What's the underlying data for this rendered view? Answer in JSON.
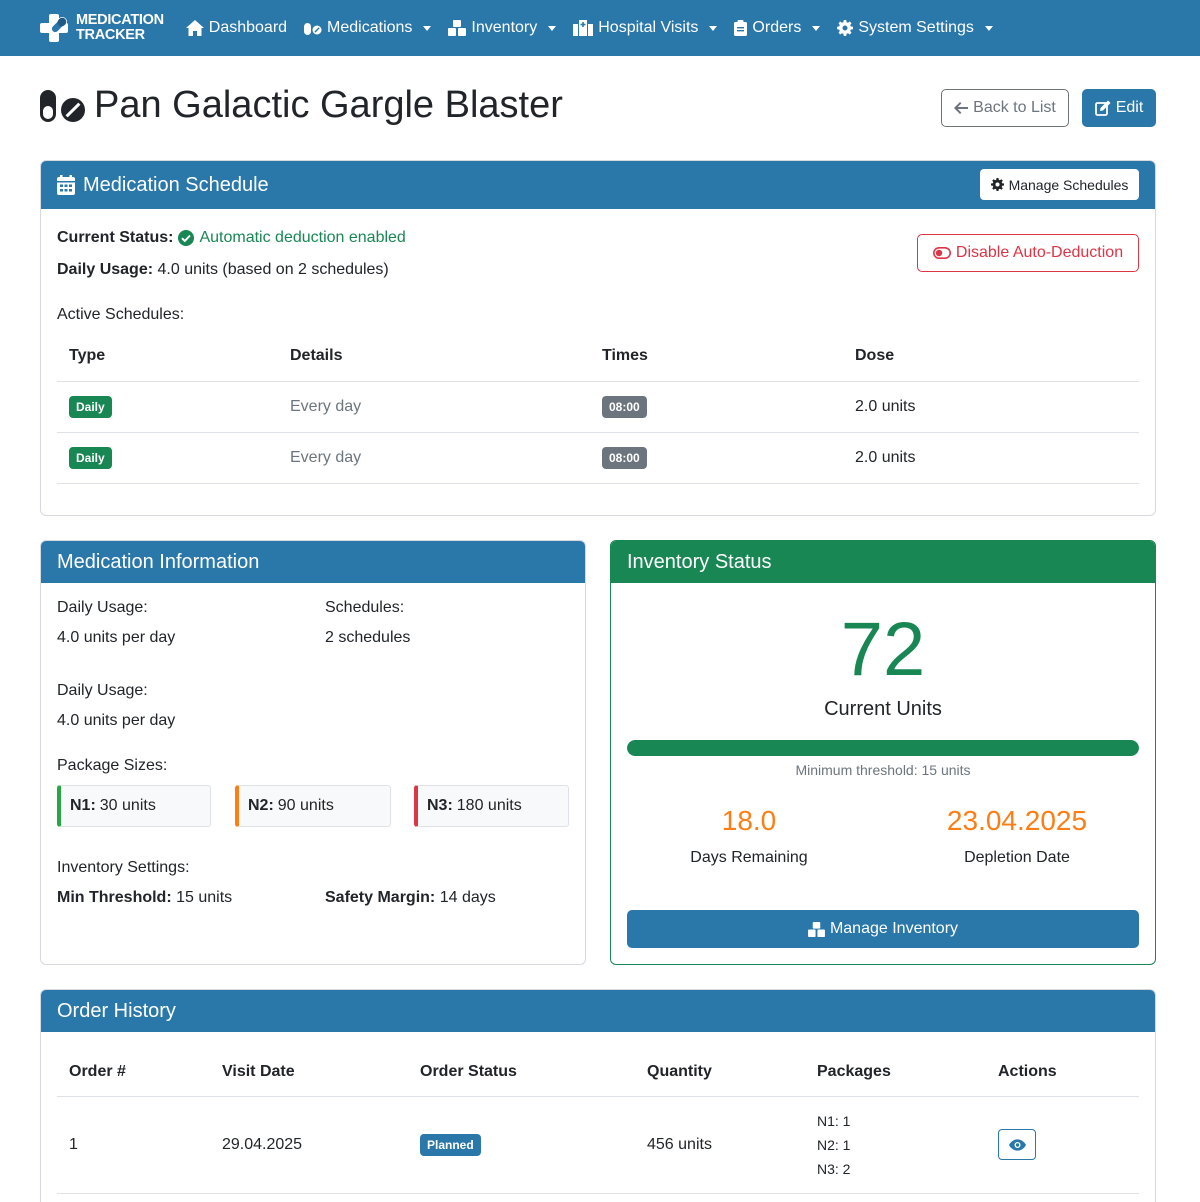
{
  "nav": {
    "brand_line1": "MEDICATION",
    "brand_line2": "TRACKER",
    "items": [
      {
        "label": "Dashboard",
        "icon": "home-icon",
        "dropdown": false
      },
      {
        "label": "Medications",
        "icon": "pills-icon",
        "dropdown": true
      },
      {
        "label": "Inventory",
        "icon": "boxes-icon",
        "dropdown": true
      },
      {
        "label": "Hospital Visits",
        "icon": "hospital-icon",
        "dropdown": true
      },
      {
        "label": "Orders",
        "icon": "clipboard-icon",
        "dropdown": true
      },
      {
        "label": "System Settings",
        "icon": "gear-icon",
        "dropdown": true
      }
    ]
  },
  "header": {
    "title": "Pan Galactic Gargle Blaster",
    "back_label": "Back to List",
    "edit_label": "Edit"
  },
  "schedule": {
    "title": "Medication Schedule",
    "manage_label": "Manage Schedules",
    "status_label": "Current Status:",
    "status_value": "Automatic deduction enabled",
    "usage_label": "Daily Usage:",
    "usage_value": "4.0 units (based on 2 schedules)",
    "disable_label": "Disable Auto-Deduction",
    "active_label": "Active Schedules:",
    "columns": [
      "Type",
      "Details",
      "Times",
      "Dose"
    ],
    "rows": [
      {
        "type": "Daily",
        "details": "Every day",
        "time": "08:00",
        "dose": "2.0 units"
      },
      {
        "type": "Daily",
        "details": "Every day",
        "time": "08:00",
        "dose": "2.0 units"
      }
    ]
  },
  "info": {
    "title": "Medication Information",
    "daily_usage_label": "Daily Usage:",
    "daily_usage_value": "4.0 units per day",
    "schedules_label": "Schedules:",
    "schedules_value": "2 schedules",
    "daily_usage_label2": "Daily Usage:",
    "daily_usage_value2": "4.0 units per day",
    "package_label": "Package Sizes:",
    "packages": [
      {
        "name": "N1:",
        "value": "30 units",
        "color": "#28a745"
      },
      {
        "name": "N2:",
        "value": "90 units",
        "color": "#fd7e14"
      },
      {
        "name": "N3:",
        "value": "180 units",
        "color": "#dc3545"
      }
    ],
    "settings_label": "Inventory Settings:",
    "min_threshold_label": "Min Threshold:",
    "min_threshold_value": "15 units",
    "safety_margin_label": "Safety Margin:",
    "safety_margin_value": "14 days"
  },
  "inventory": {
    "title": "Inventory Status",
    "current_units": "72",
    "current_units_label": "Current Units",
    "progress_fraction": 1.0,
    "threshold_text": "Minimum threshold: 15 units",
    "days_remaining": "18.0",
    "days_remaining_label": "Days Remaining",
    "depletion_date": "23.04.2025",
    "depletion_date_label": "Depletion Date",
    "manage_label": "Manage Inventory",
    "accent_color": "#198754",
    "warning_color": "#fd7e14"
  },
  "orders": {
    "title": "Order History",
    "columns": [
      "Order #",
      "Visit Date",
      "Order Status",
      "Quantity",
      "Packages",
      "Actions"
    ],
    "rows": [
      {
        "order": "1",
        "date": "29.04.2025",
        "status": "Planned",
        "quantity": "456 units",
        "packages": [
          "N1: 1",
          "N2: 1",
          "N3: 2"
        ]
      }
    ]
  }
}
